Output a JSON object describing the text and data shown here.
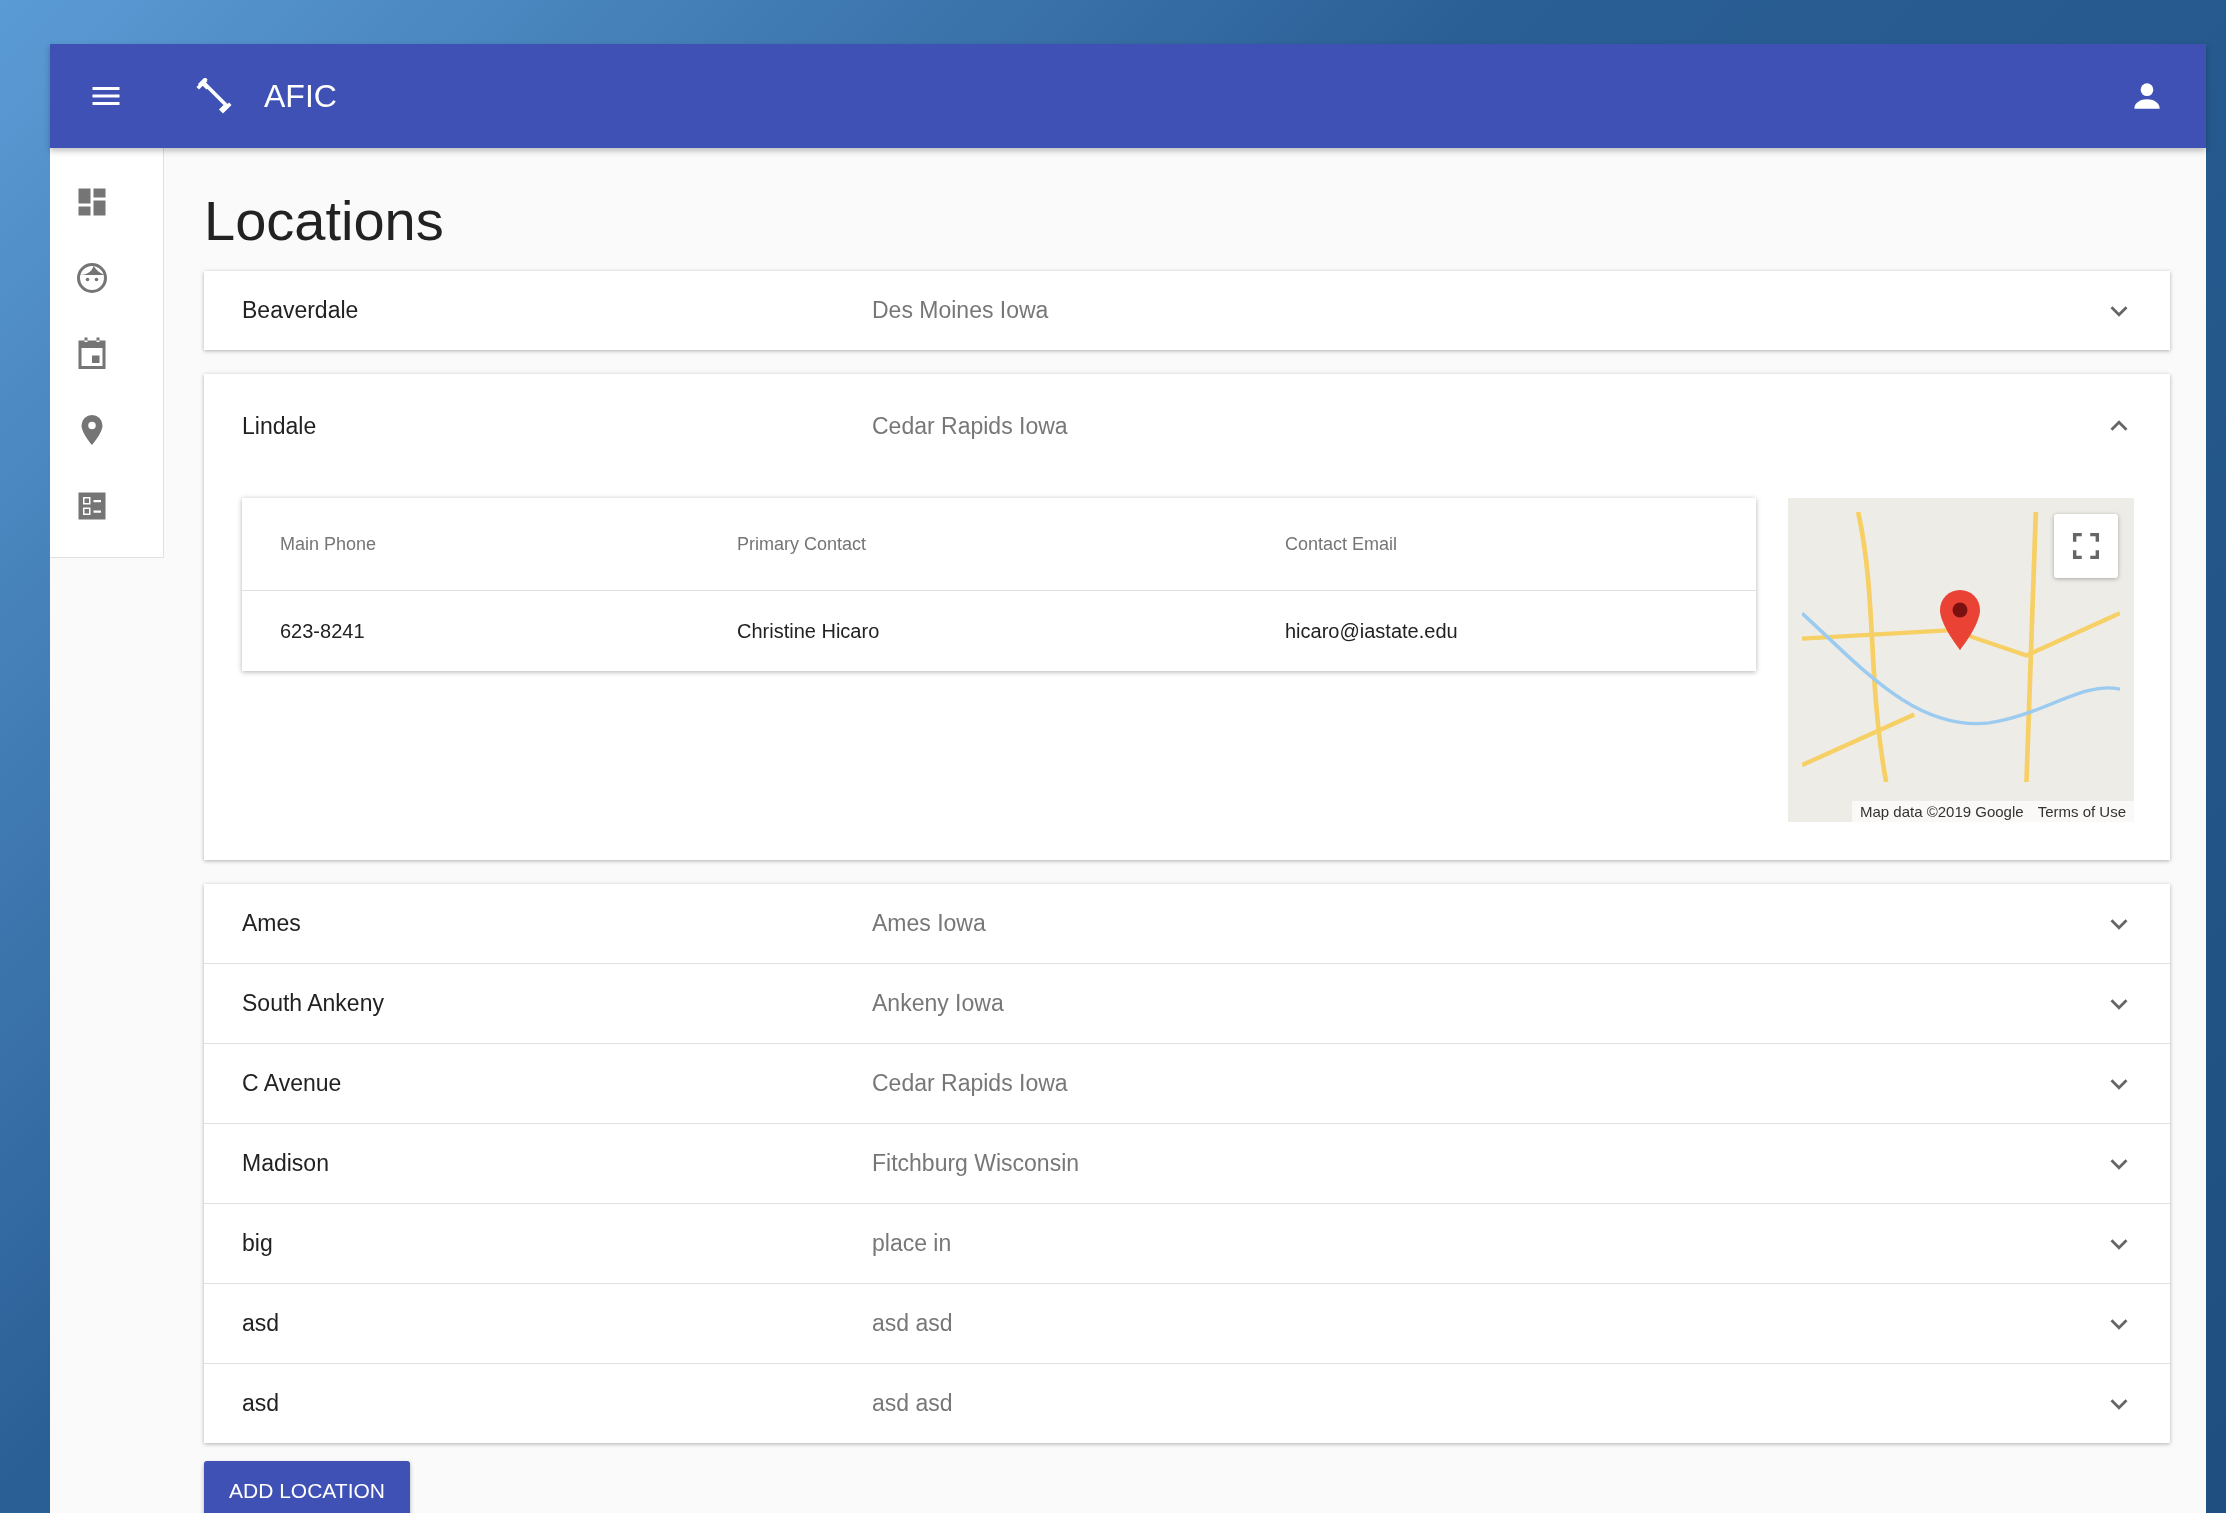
{
  "app_bar": {
    "title": "AFIC"
  },
  "page_title": "Locations",
  "locations": [
    {
      "name": "Beaverdale",
      "city": "Des Moines Iowa",
      "expanded": false
    },
    {
      "name": "Lindale",
      "city": "Cedar Rapids Iowa",
      "expanded": true,
      "details": {
        "columns": [
          "Main Phone",
          "Primary Contact",
          "Contact Email"
        ],
        "row": [
          "623-8241",
          "Christine Hicaro",
          "hicaro@iastate.edu"
        ]
      },
      "map": {
        "attribution": "Map data ©2019 Google",
        "terms": "Terms of Use"
      }
    },
    {
      "name": "Ames",
      "city": "Ames Iowa",
      "expanded": false
    },
    {
      "name": "South Ankeny",
      "city": "Ankeny Iowa",
      "expanded": false
    },
    {
      "name": "C Avenue",
      "city": "Cedar Rapids Iowa",
      "expanded": false
    },
    {
      "name": "Madison",
      "city": "Fitchburg Wisconsin",
      "expanded": false
    },
    {
      "name": "big",
      "city": "place in",
      "expanded": false
    },
    {
      "name": "asd",
      "city": "asd asd",
      "expanded": false
    },
    {
      "name": "asd",
      "city": "asd asd",
      "expanded": false
    }
  ],
  "add_button": "ADD LOCATION"
}
